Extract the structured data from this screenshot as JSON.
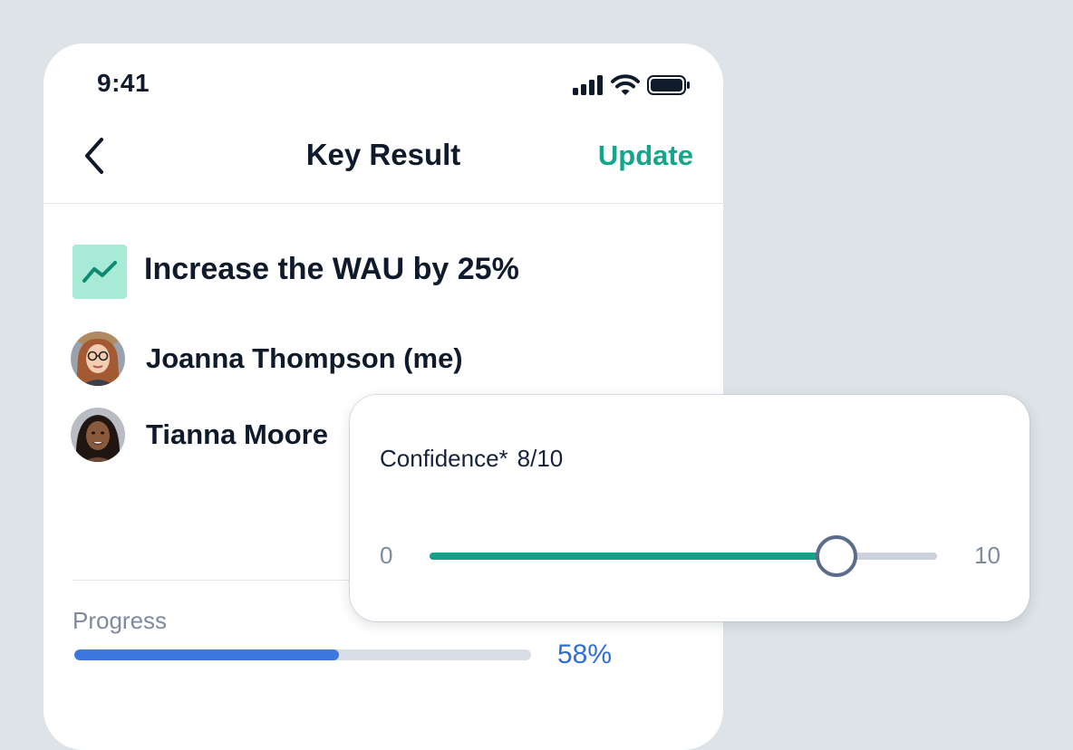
{
  "status_bar": {
    "time": "9:41"
  },
  "nav": {
    "back_icon": "chevron-left-icon",
    "title": "Key Result",
    "action_label": "Update"
  },
  "key_result": {
    "icon": "trend-line-icon",
    "title": "Increase the WAU by 25%"
  },
  "owners": [
    {
      "name": "Joanna Thompson (me)"
    },
    {
      "name": "Tianna Moore"
    }
  ],
  "progress": {
    "label": "Progress",
    "value_text": "58%",
    "fraction": 0.58
  },
  "confidence": {
    "label": "Confidence*",
    "value_text": "8/10",
    "min": "0",
    "max": "10",
    "value": 8,
    "range": [
      0,
      10
    ]
  },
  "colors": {
    "accent": "#12a68c",
    "progress": "#3c78e0",
    "progress_text": "#2f6fd4",
    "background": "#dde3e6"
  }
}
